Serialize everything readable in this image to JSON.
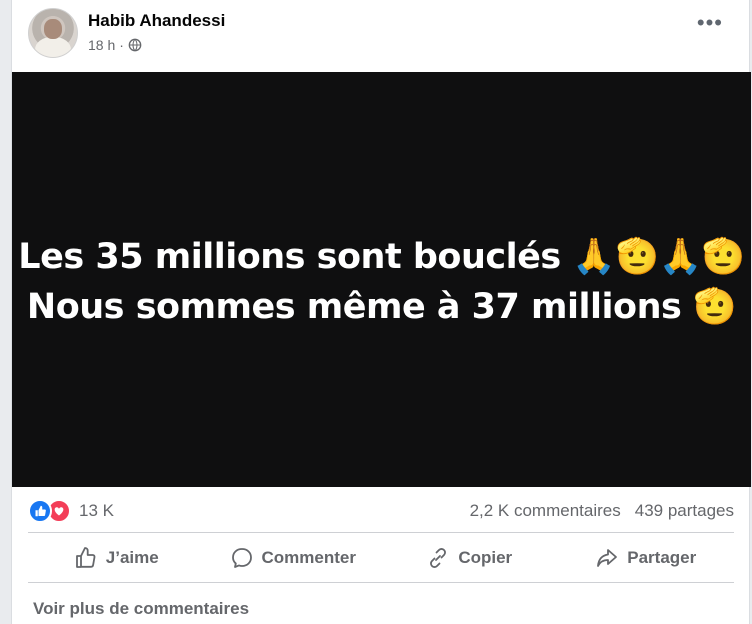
{
  "post": {
    "author": "Habib Ahandessi",
    "time": "18 h",
    "separator": "·",
    "privacy_icon": "globe-icon",
    "more_icon": "ellipsis-icon",
    "more_label": "•••"
  },
  "media": {
    "line1": "Les 35 millions sont bouclés 🙏🫡🙏🫡",
    "line2": "Nous sommes même à 37 millions 🫡",
    "background": "#0f0f10"
  },
  "stats": {
    "reactions": [
      "like-icon",
      "love-icon"
    ],
    "reaction_count": "13 K",
    "comments": "2,2 K commentaires",
    "shares": "439 partages"
  },
  "actions": {
    "like": "J’aime",
    "comment": "Commenter",
    "copy": "Copier",
    "share": "Partager"
  },
  "footer": {
    "more_comments": "Voir plus de commentaires"
  },
  "colors": {
    "like_blue": "#1877f2",
    "love_red": "#f33e58",
    "secondary_text": "#65676b"
  }
}
